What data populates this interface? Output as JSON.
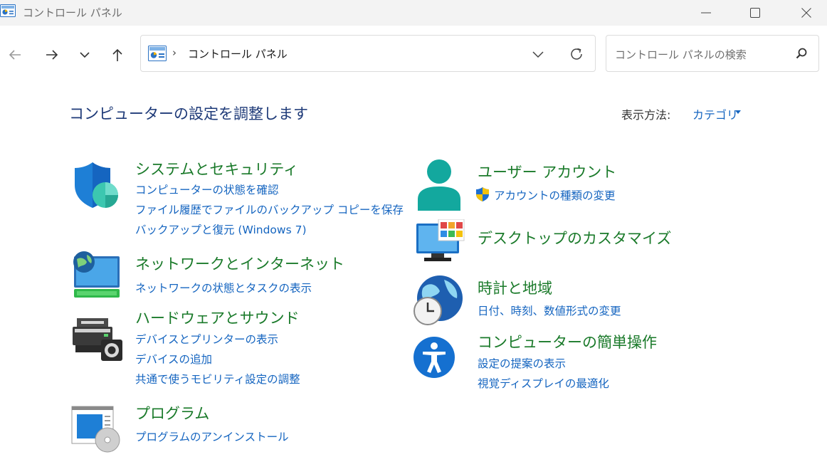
{
  "window": {
    "title": "コントロール パネル"
  },
  "address": {
    "separator": "›",
    "path": "コントロール パネル"
  },
  "search": {
    "placeholder": "コントロール パネルの検索"
  },
  "main": {
    "heading": "コンピューターの設定を調整します",
    "view_label": "表示方法:",
    "view_value": "カテゴリ"
  },
  "categories_left": [
    {
      "title": "システムとセキュリティ",
      "links": [
        "コンピューターの状態を確認",
        "ファイル履歴でファイルのバックアップ コピーを保存",
        "バックアップと復元 (Windows 7)"
      ]
    },
    {
      "title": "ネットワークとインターネット",
      "links": [
        "ネットワークの状態とタスクの表示"
      ]
    },
    {
      "title": "ハードウェアとサウンド",
      "links": [
        "デバイスとプリンターの表示",
        "デバイスの追加",
        "共通で使うモビリティ設定の調整"
      ]
    },
    {
      "title": "プログラム",
      "links": [
        "プログラムのアンインストール"
      ]
    }
  ],
  "categories_right": [
    {
      "title": "ユーザー アカウント",
      "links": [
        "アカウントの種類の変更"
      ]
    },
    {
      "title": "デスクトップのカスタマイズ",
      "links": []
    },
    {
      "title": "時計と地域",
      "links": [
        "日付、時刻、数値形式の変更"
      ]
    },
    {
      "title": "コンピューターの簡単操作",
      "links": [
        "設定の提案の表示",
        "視覚ディスプレイの最適化"
      ]
    }
  ],
  "colors": {
    "category_title": "#1a7a2a",
    "link": "#1565c0",
    "heading": "#1e3a78"
  },
  "icons": {
    "system_security": "shield-icon",
    "network_internet": "network-globe-icon",
    "hardware_sound": "printer-icon",
    "programs": "programs-disc-icon",
    "user_accounts": "user-icon",
    "desktop_customization": "monitor-icon",
    "clock_region": "globe-clock-icon",
    "ease_of_access": "accessibility-icon"
  }
}
